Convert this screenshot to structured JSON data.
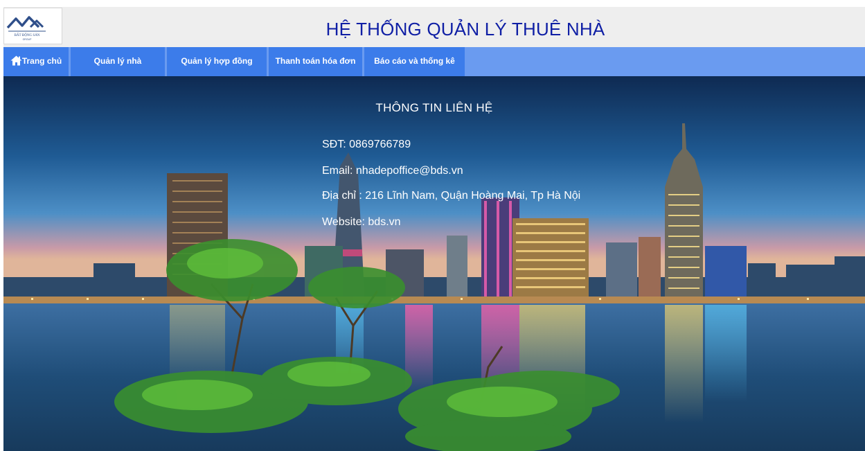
{
  "header": {
    "title": "HỆ THỐNG QUẢN LÝ THUÊ NHÀ",
    "logo": {
      "icon": "roof-logo-icon",
      "text": "BẤT ĐỘNG SẢN",
      "subtext": "GROUP"
    }
  },
  "nav": {
    "items": [
      {
        "label": "Trang chủ",
        "icon": "home-icon"
      },
      {
        "label": "Quản lý nhà"
      },
      {
        "label": "Quản lý hợp đồng"
      },
      {
        "label": "Thanh toán hóa đơn"
      },
      {
        "label": "Báo cáo và thống kê"
      }
    ]
  },
  "contact": {
    "title": "THÔNG TIN LIÊN HỆ",
    "phone": "SĐT: 0869766789",
    "email": "Email: nhadepoffice@bds.vn",
    "address": "Địa chỉ : 216 Lĩnh Nam, Quận Hoàng Mai, Tp Hà Nội",
    "website": "Website: bds.vn"
  },
  "colors": {
    "title": "#0f1fa5",
    "nav_bar": "#6a9bf0",
    "nav_item": "#3c7cea",
    "header_bg": "#eeeeee"
  }
}
